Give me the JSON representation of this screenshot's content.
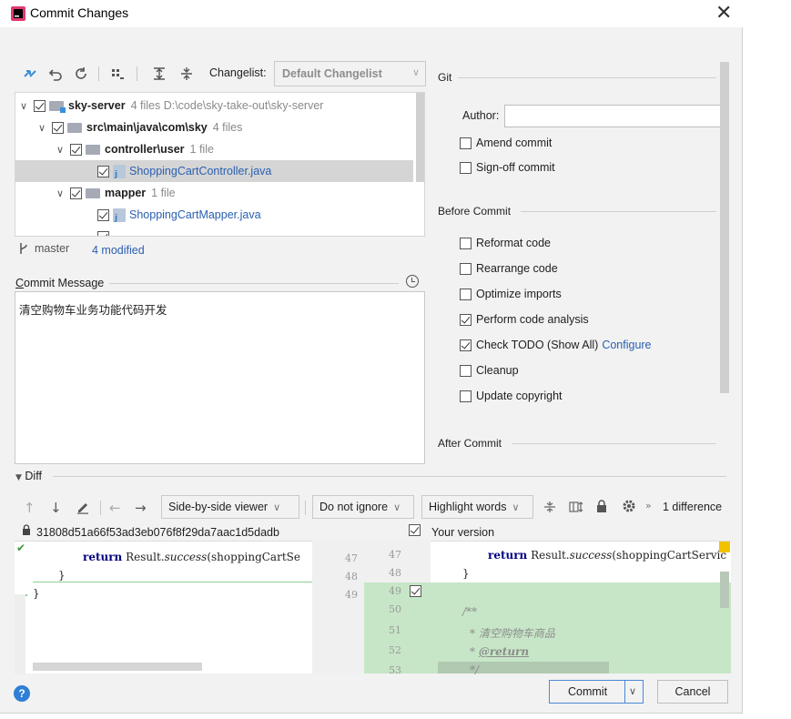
{
  "window": {
    "title": "Commit Changes",
    "close_glyph": "✕",
    "accent": "#2a5fb0"
  },
  "toolbar": {
    "changelist_label": "Changelist:",
    "changelist_value": "Default Changelist"
  },
  "tree": {
    "rows": [
      {
        "name": "sky-server",
        "meta": "4 files  D:\\code\\sky-take-out\\sky-server"
      },
      {
        "name": "src\\main\\java\\com\\sky",
        "meta": "4 files"
      },
      {
        "name": "controller\\user",
        "meta": "1 file"
      },
      {
        "name": "ShoppingCartController.java"
      },
      {
        "name": "mapper",
        "meta": "1 file"
      },
      {
        "name": "ShoppingCartMapper.java"
      }
    ]
  },
  "status": {
    "branch": "master",
    "modified": "4 modified"
  },
  "commit_message": {
    "label": "Commit Message",
    "text": "清空购物车业务功能代码开发"
  },
  "git": {
    "section": "Git",
    "author_label": "Author:",
    "author_value": "",
    "amend": "Amend commit",
    "signoff": "Sign-off commit"
  },
  "before_commit": {
    "section": "Before Commit",
    "reformat": "Reformat code",
    "rearrange": "Rearrange code",
    "optimize": "Optimize imports",
    "analysis": "Perform code analysis",
    "todo": "Check TODO (Show All)",
    "configure": "Configure",
    "cleanup": "Cleanup",
    "copyright": "Update copyright"
  },
  "after_commit": {
    "section": "After Commit"
  },
  "diff": {
    "label": "Diff",
    "viewer": "Side-by-side viewer",
    "ignore": "Do not ignore",
    "highlight": "Highlight words",
    "count": "1 difference",
    "left_header": "31808d51a66f53ad3eb076f8f29da7aac1d5dadb",
    "right_header": "Your version",
    "left_lines": {
      "l1_kw": "return",
      "l1_rest": " Result.",
      "l1_it": "success",
      "l1_tail": "(shoppingCartSe",
      "l2": "}",
      "l3": "}"
    },
    "right_lines": {
      "r1_kw": "return",
      "r1_rest": " Result.",
      "r1_it": "success",
      "r1_tail": "(shoppingCartServic",
      "r2": "}",
      "c1": "/**",
      "c2": "* 清空购物车商品",
      "c3_star": "* ",
      "c3_tag": "@return",
      "c4": "*/"
    },
    "nums": {
      "l1": "47",
      "l2": "48",
      "l3": "49",
      "r1": "47",
      "r2": "48",
      "r3": "49",
      "r4": "50",
      "r5": "51",
      "r6": "52",
      "r7": "53"
    }
  },
  "buttons": {
    "commit": "Commit",
    "cancel": "Cancel",
    "help": "?"
  }
}
